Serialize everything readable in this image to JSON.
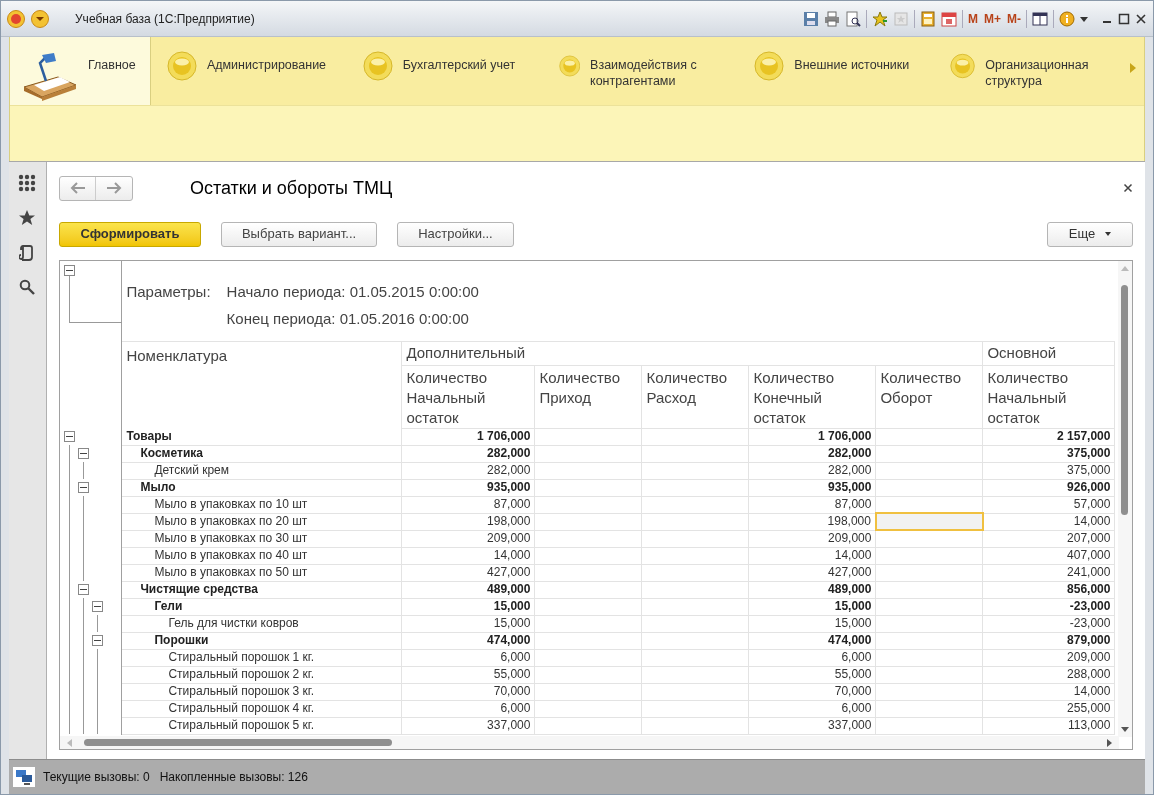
{
  "window": {
    "title": "Учебная база (1С:Предприятие)"
  },
  "memory_buttons": [
    "M",
    "M+",
    "M-"
  ],
  "sections": [
    {
      "label": "Главное",
      "selected": true
    },
    {
      "label": "Администрирование",
      "selected": false
    },
    {
      "label": "Бухгалтерский учет",
      "selected": false
    },
    {
      "label": "Взаимодействия с контрагентами",
      "selected": false
    },
    {
      "label": "Внешние источники",
      "selected": false
    },
    {
      "label": "Организационная структура",
      "selected": false
    }
  ],
  "report": {
    "title": "Остатки и обороты ТМЦ",
    "buttons": [
      {
        "label": "Сформировать",
        "kind": "primary"
      },
      {
        "label": "Выбрать вариант...",
        "kind": "default"
      },
      {
        "label": "Настройки...",
        "kind": "default"
      }
    ],
    "more_button": "Еще",
    "parameters_label": "Параметры:",
    "parameters": [
      "Начало периода: 01.05.2015 0:00:00",
      "Конец периода: 01.05.2016 0:00:00"
    ],
    "table": {
      "name_column": "Номенклатура",
      "groups": [
        {
          "label": "Дополнительный",
          "columns": [
            "Количество Начальный остаток",
            "Количество Приход",
            "Количество Расход",
            "Количество Конечный остаток",
            "Количество Оборот"
          ]
        },
        {
          "label": "Основной",
          "columns": [
            "Количество Начальный остаток"
          ]
        }
      ],
      "rows": [
        {
          "name": "Товары",
          "kind": "group",
          "expanded": true,
          "start": "1 706,000",
          "end": "1 706,000",
          "main_start": "2 157,000",
          "turnover_selected": false,
          "children": [
            {
              "name": "Косметика",
              "kind": "group",
              "expanded": true,
              "start": "282,000",
              "end": "282,000",
              "main_start": "375,000",
              "turnover_selected": false,
              "children": [
                {
                  "name": "Детский крем",
                  "kind": "item",
                  "start": "282,000",
                  "end": "282,000",
                  "main_start": "375,000",
                  "turnover_selected": false
                }
              ]
            },
            {
              "name": "Мыло",
              "kind": "group",
              "expanded": true,
              "start": "935,000",
              "end": "935,000",
              "main_start": "926,000",
              "turnover_selected": false,
              "children": [
                {
                  "name": "Мыло в упаковках по 10 шт",
                  "kind": "item",
                  "start": "87,000",
                  "end": "87,000",
                  "main_start": "57,000",
                  "turnover_selected": false
                },
                {
                  "name": "Мыло в упаковках по 20 шт",
                  "kind": "item",
                  "start": "198,000",
                  "end": "198,000",
                  "main_start": "14,000",
                  "turnover_selected": true
                },
                {
                  "name": "Мыло в упаковках по 30 шт",
                  "kind": "item",
                  "start": "209,000",
                  "end": "209,000",
                  "main_start": "207,000",
                  "turnover_selected": false
                },
                {
                  "name": "Мыло в упаковках по 40 шт",
                  "kind": "item",
                  "start": "14,000",
                  "end": "14,000",
                  "main_start": "407,000",
                  "turnover_selected": false
                },
                {
                  "name": "Мыло в упаковках по 50 шт",
                  "kind": "item",
                  "start": "427,000",
                  "end": "427,000",
                  "main_start": "241,000",
                  "turnover_selected": false
                }
              ]
            },
            {
              "name": "Чистящие средства",
              "kind": "group",
              "expanded": true,
              "start": "489,000",
              "end": "489,000",
              "main_start": "856,000",
              "turnover_selected": false,
              "children": [
                {
                  "name": "Гели",
                  "kind": "group",
                  "expanded": true,
                  "start": "15,000",
                  "end": "15,000",
                  "main_start": "-23,000",
                  "turnover_selected": false,
                  "children": [
                    {
                      "name": "Гель для чистки ковров",
                      "kind": "item",
                      "start": "15,000",
                      "end": "15,000",
                      "main_start": "-23,000",
                      "turnover_selected": false
                    }
                  ]
                },
                {
                  "name": "Порошки",
                  "kind": "group",
                  "expanded": true,
                  "start": "474,000",
                  "end": "474,000",
                  "main_start": "879,000",
                  "turnover_selected": false,
                  "children": [
                    {
                      "name": "Стиральный порошок 1 кг.",
                      "kind": "item",
                      "start": "6,000",
                      "end": "6,000",
                      "main_start": "209,000",
                      "turnover_selected": false
                    },
                    {
                      "name": "Стиральный порошок 2 кг.",
                      "kind": "item",
                      "start": "55,000",
                      "end": "55,000",
                      "main_start": "288,000",
                      "turnover_selected": false
                    },
                    {
                      "name": "Стиральный порошок 3 кг.",
                      "kind": "item",
                      "start": "70,000",
                      "end": "70,000",
                      "main_start": "14,000",
                      "turnover_selected": false
                    },
                    {
                      "name": "Стиральный порошок 4 кг.",
                      "kind": "item",
                      "start": "6,000",
                      "end": "6,000",
                      "main_start": "255,000",
                      "turnover_selected": false
                    },
                    {
                      "name": "Стиральный порошок 5 кг.",
                      "kind": "item",
                      "start": "337,000",
                      "end": "337,000",
                      "main_start": "113,000",
                      "turnover_selected": false
                    }
                  ]
                }
              ]
            }
          ]
        }
      ]
    }
  },
  "status_bar": [
    "Текущие вызовы: 0",
    "Накопленные вызовы: 126"
  ]
}
